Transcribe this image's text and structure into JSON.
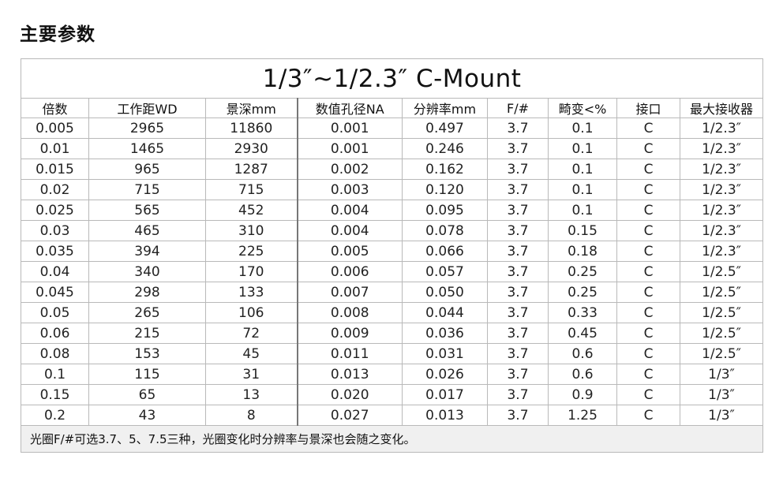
{
  "section_title": "主要参数",
  "table": {
    "title": "1/3″~1/2.3″   C-Mount",
    "columns": [
      "倍数",
      "工作距WD",
      "景深mm",
      "数值孔径NA",
      "分辨率mm",
      "F/#",
      "畸变<%",
      "接口",
      "最大接收器"
    ],
    "rows": [
      [
        "0.005",
        "2965",
        "11860",
        "0.001",
        "0.497",
        "3.7",
        "0.1",
        "C",
        "1/2.3″"
      ],
      [
        "0.01",
        "1465",
        "2930",
        "0.001",
        "0.246",
        "3.7",
        "0.1",
        "C",
        "1/2.3″"
      ],
      [
        "0.015",
        "965",
        "1287",
        "0.002",
        "0.162",
        "3.7",
        "0.1",
        "C",
        "1/2.3″"
      ],
      [
        "0.02",
        "715",
        "715",
        "0.003",
        "0.120",
        "3.7",
        "0.1",
        "C",
        "1/2.3″"
      ],
      [
        "0.025",
        "565",
        "452",
        "0.004",
        "0.095",
        "3.7",
        "0.1",
        "C",
        "1/2.3″"
      ],
      [
        "0.03",
        "465",
        "310",
        "0.004",
        "0.078",
        "3.7",
        "0.15",
        "C",
        "1/2.3″"
      ],
      [
        "0.035",
        "394",
        "225",
        "0.005",
        "0.066",
        "3.7",
        "0.18",
        "C",
        "1/2.3″"
      ],
      [
        "0.04",
        "340",
        "170",
        "0.006",
        "0.057",
        "3.7",
        "0.25",
        "C",
        "1/2.5″"
      ],
      [
        "0.045",
        "298",
        "133",
        "0.007",
        "0.050",
        "3.7",
        "0.25",
        "C",
        "1/2.5″"
      ],
      [
        "0.05",
        "265",
        "106",
        "0.008",
        "0.044",
        "3.7",
        "0.33",
        "C",
        "1/2.5″"
      ],
      [
        "0.06",
        "215",
        "72",
        "0.009",
        "0.036",
        "3.7",
        "0.45",
        "C",
        "1/2.5″"
      ],
      [
        "0.08",
        "153",
        "45",
        "0.011",
        "0.031",
        "3.7",
        "0.6",
        "C",
        "1/2.5″"
      ],
      [
        "0.1",
        "115",
        "31",
        "0.013",
        "0.026",
        "3.7",
        "0.6",
        "C",
        "1/3″"
      ],
      [
        "0.15",
        "65",
        "13",
        "0.020",
        "0.017",
        "3.7",
        "0.9",
        "C",
        "1/3″"
      ],
      [
        "0.2",
        "43",
        "8",
        "0.027",
        "0.013",
        "3.7",
        "1.25",
        "C",
        "1/3″"
      ]
    ],
    "note": "光圈F/#可选3.7、5、7.5三种，光圈变化时分辨率与景深也会随之变化。"
  }
}
